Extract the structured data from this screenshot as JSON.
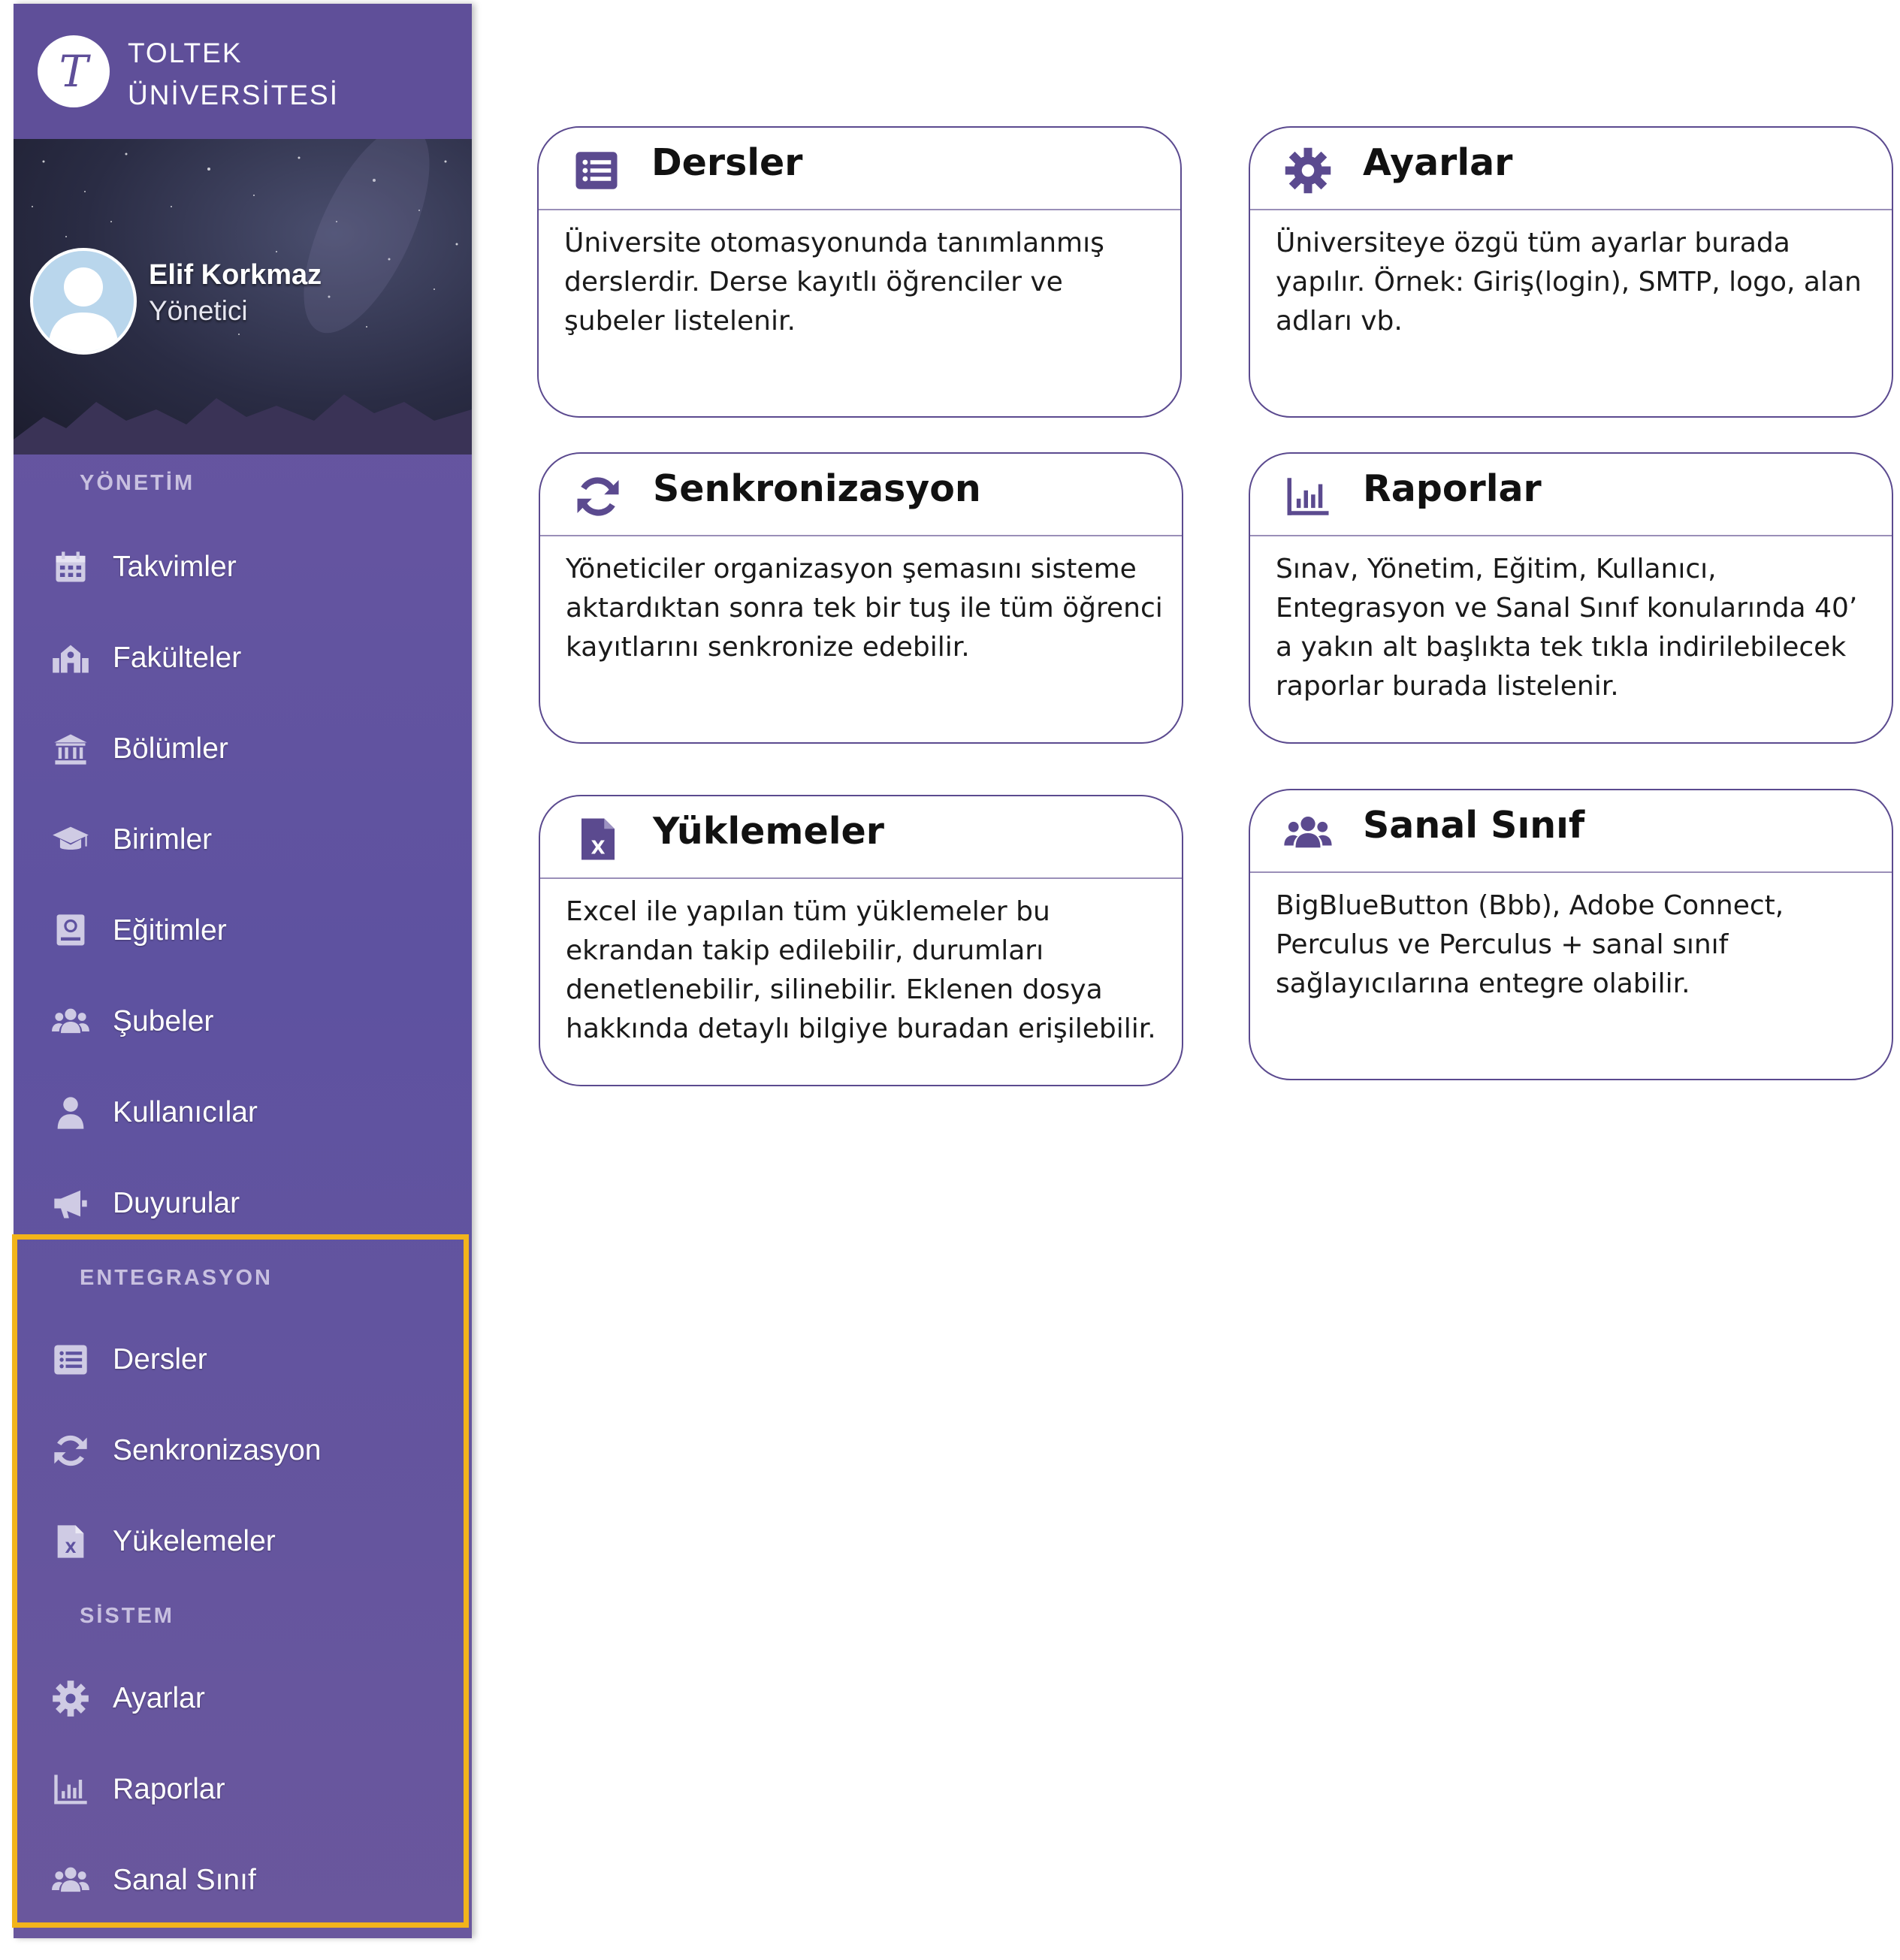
{
  "brand": {
    "line1": "TOLTEK",
    "line2": "ÜNİVERSİTESİ",
    "logo_letter": "T"
  },
  "user": {
    "name": "Elif Korkmaz",
    "role": "Yönetici"
  },
  "sections": {
    "management": "YÖNETİM",
    "integration": "ENTEGRASYON",
    "system": "SİSTEM"
  },
  "nav": {
    "management": [
      {
        "label": "Takvimler",
        "icon": "calendar-icon"
      },
      {
        "label": "Fakülteler",
        "icon": "faculty-icon"
      },
      {
        "label": "Bölümler",
        "icon": "university-icon"
      },
      {
        "label": "Birimler",
        "icon": "graduation-cap-icon"
      },
      {
        "label": "Eğitimler",
        "icon": "training-icon"
      },
      {
        "label": "Şubeler",
        "icon": "users-icon"
      },
      {
        "label": "Kullanıcılar",
        "icon": "user-icon"
      },
      {
        "label": "Duyurular",
        "icon": "megaphone-icon"
      }
    ],
    "integration": [
      {
        "label": "Dersler",
        "icon": "list-icon"
      },
      {
        "label": "Senkronizasyon",
        "icon": "sync-icon"
      },
      {
        "label": "Yükelemeler",
        "icon": "excel-file-icon"
      }
    ],
    "system": [
      {
        "label": "Ayarlar",
        "icon": "gear-icon"
      },
      {
        "label": "Raporlar",
        "icon": "bar-chart-icon"
      },
      {
        "label": "Sanal Sınıf",
        "icon": "users-icon"
      }
    ]
  },
  "cards": [
    {
      "title": "Dersler",
      "icon": "list-icon",
      "text": "Üniversite otomasyonunda tanımlanmış derslerdir. Derse kayıtlı öğrenciler ve şubeler listelenir."
    },
    {
      "title": "Ayarlar",
      "icon": "gear-icon",
      "text": "Üniversiteye özgü tüm ayarlar burada yapılır. Örnek: Giriş(login), SMTP, logo, alan adları vb."
    },
    {
      "title": "Senkronizasyon",
      "icon": "sync-icon",
      "text": "Yöneticiler organizasyon şemasını sisteme aktardıktan sonra tek bir tuş ile tüm öğrenci kayıtlarını senkronize edebilir."
    },
    {
      "title": "Raporlar",
      "icon": "bar-chart-icon",
      "text": "Sınav, Yönetim, Eğitim, Kullanıcı, Entegrasyon ve Sanal Sınıf konularında 40’ a yakın alt başlıkta tek tıkla indirilebilecek raporlar burada listelenir."
    },
    {
      "title": "Yüklemeler",
      "icon": "excel-file-icon",
      "text": "Excel ile yapılan tüm yüklemeler bu ekrandan takip edilebilir, durumları denetlenebilir, silinebilir. Eklenen dosya hakkında detaylı bilgiye buradan erişilebilir."
    },
    {
      "title": "Sanal Sınıf",
      "icon": "users-icon",
      "text": "BigBlueButton (Bbb), Adobe Connect, Perculus ve Perculus + sanal sınıf sağlayıcılarına entegre olabilir."
    }
  ],
  "colors": {
    "sidebar": "#5e52a0",
    "accent": "#5b4a8f",
    "highlight": "#f2b41b"
  }
}
